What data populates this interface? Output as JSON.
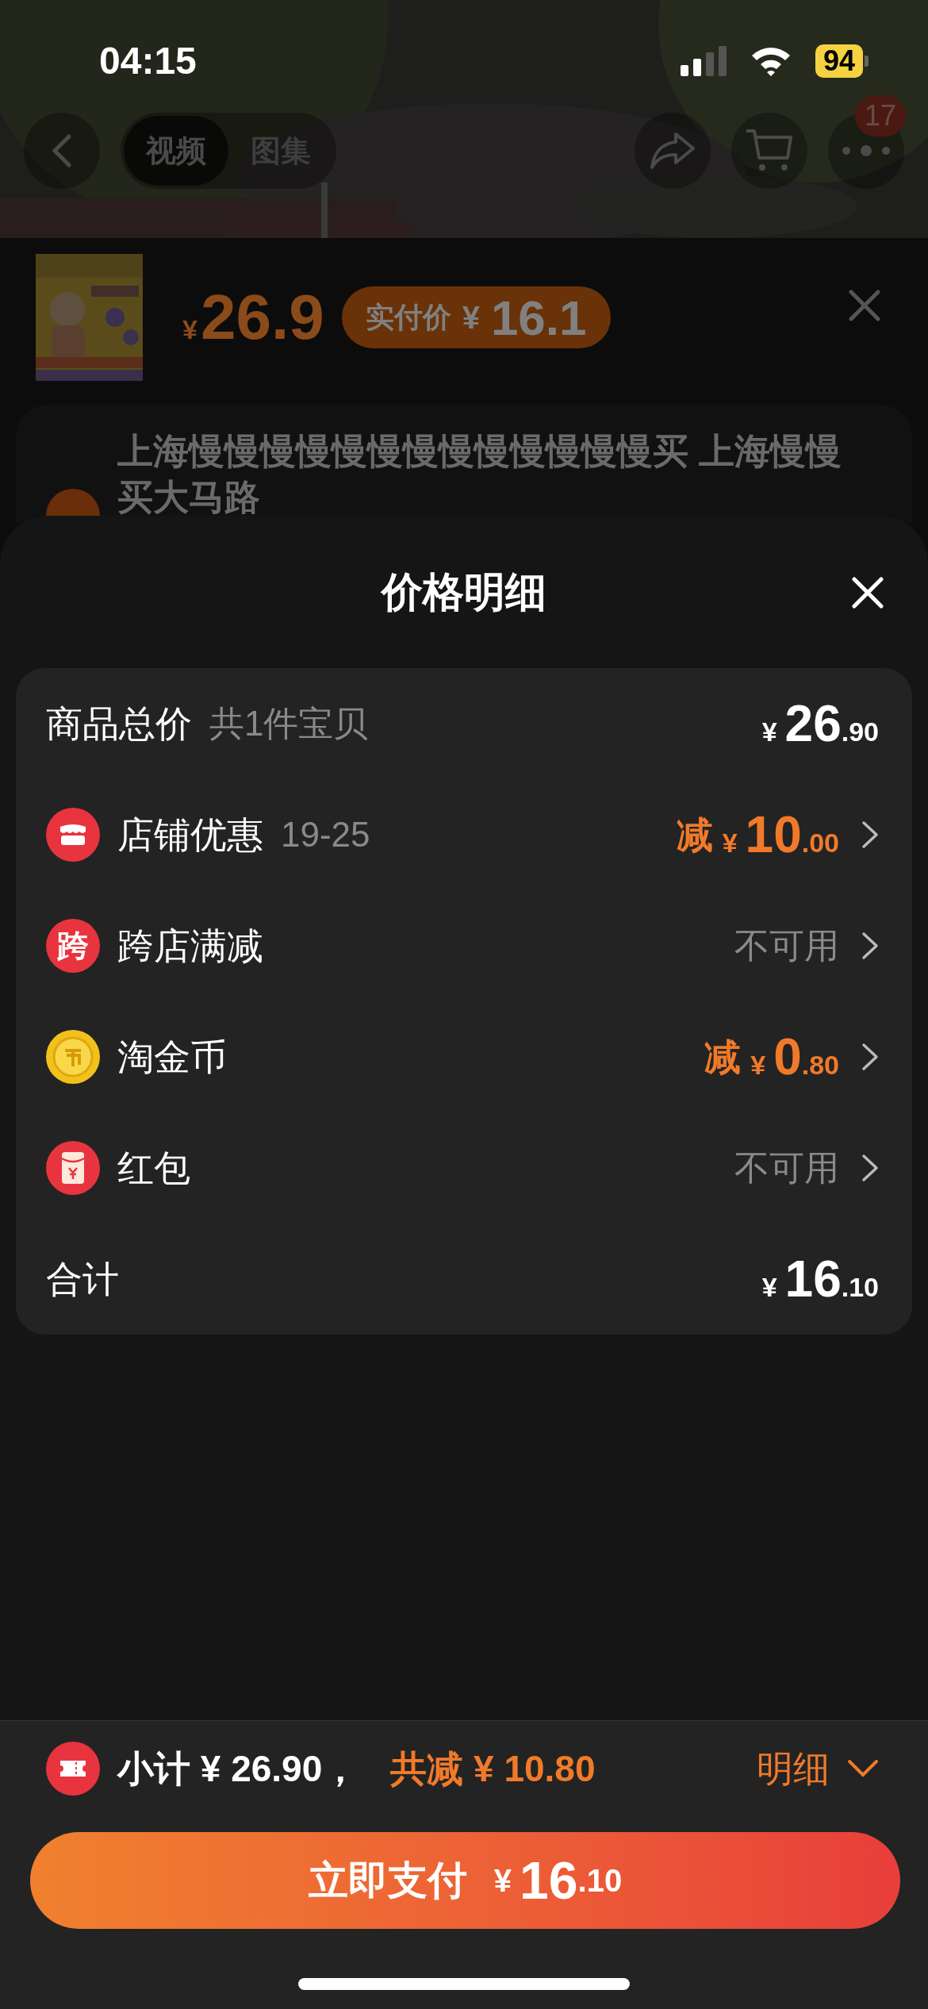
{
  "status_bar": {
    "time": "04:15",
    "battery": "94"
  },
  "nav": {
    "tabs": [
      {
        "label": "视频",
        "selected": true
      },
      {
        "label": "图集",
        "selected": false
      }
    ],
    "badge": "17"
  },
  "product": {
    "price": {
      "currency": "¥",
      "amount": "26.9"
    },
    "actual_price": {
      "label": "实付价",
      "currency": "¥",
      "amount": "16.1"
    }
  },
  "address": {
    "text": "上海慢慢慢慢慢慢慢慢慢慢慢慢慢买 上海慢慢买大马路"
  },
  "sheet": {
    "title": "价格明细",
    "rows": [
      {
        "kind": "amount",
        "label": "商品总价",
        "note": "共1件宝贝",
        "amount": {
          "currency": "¥",
          "integer": "26",
          "decimal": ".90"
        }
      },
      {
        "kind": "discount",
        "label": "店铺优惠",
        "note": "19-25",
        "prefix": "减",
        "amount": {
          "currency": "¥",
          "integer": "10",
          "decimal": ".00"
        }
      },
      {
        "kind": "unavailable",
        "icon_text": "跨",
        "label": "跨店满减",
        "status": "不可用"
      },
      {
        "kind": "discount",
        "label": "淘金币",
        "prefix": "减",
        "amount": {
          "currency": "¥",
          "integer": "0",
          "decimal": ".80"
        }
      },
      {
        "kind": "unavailable",
        "label": "红包",
        "status": "不可用"
      },
      {
        "kind": "amount",
        "label": "合计",
        "amount": {
          "currency": "¥",
          "integer": "16",
          "decimal": ".10"
        }
      }
    ]
  },
  "footer": {
    "subtotal": "小计 ¥ 26.90，",
    "saved": "共减 ¥ 10.80",
    "details": "明细",
    "pay_button": {
      "label": "立即支付",
      "currency": "¥",
      "integer": "16",
      "decimal": ".10"
    }
  }
}
